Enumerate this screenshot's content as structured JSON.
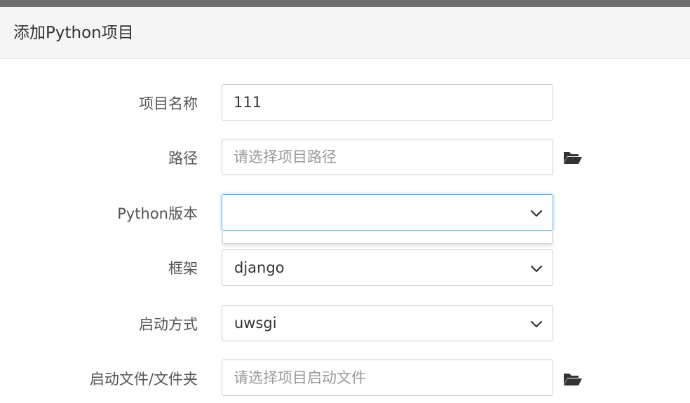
{
  "dialog": {
    "title": "添加Python项目"
  },
  "form": {
    "project_name": {
      "label": "项目名称",
      "value": "111"
    },
    "path": {
      "label": "路径",
      "placeholder": "请选择项目路径"
    },
    "python_version": {
      "label": "Python版本",
      "selected": ""
    },
    "framework": {
      "label": "框架",
      "selected": "django"
    },
    "startup_mode": {
      "label": "启动方式",
      "selected": "uwsgi"
    },
    "startup_file": {
      "label": "启动文件/文件夹",
      "placeholder": "请选择项目启动文件"
    }
  },
  "icons": {
    "folder": "folder-open-icon",
    "dropdown": "chevron-down-icon"
  },
  "colors": {
    "focus_border": "#66afe9",
    "header_bg": "#f5f5f5",
    "top_bar": "#6e6e6e"
  }
}
